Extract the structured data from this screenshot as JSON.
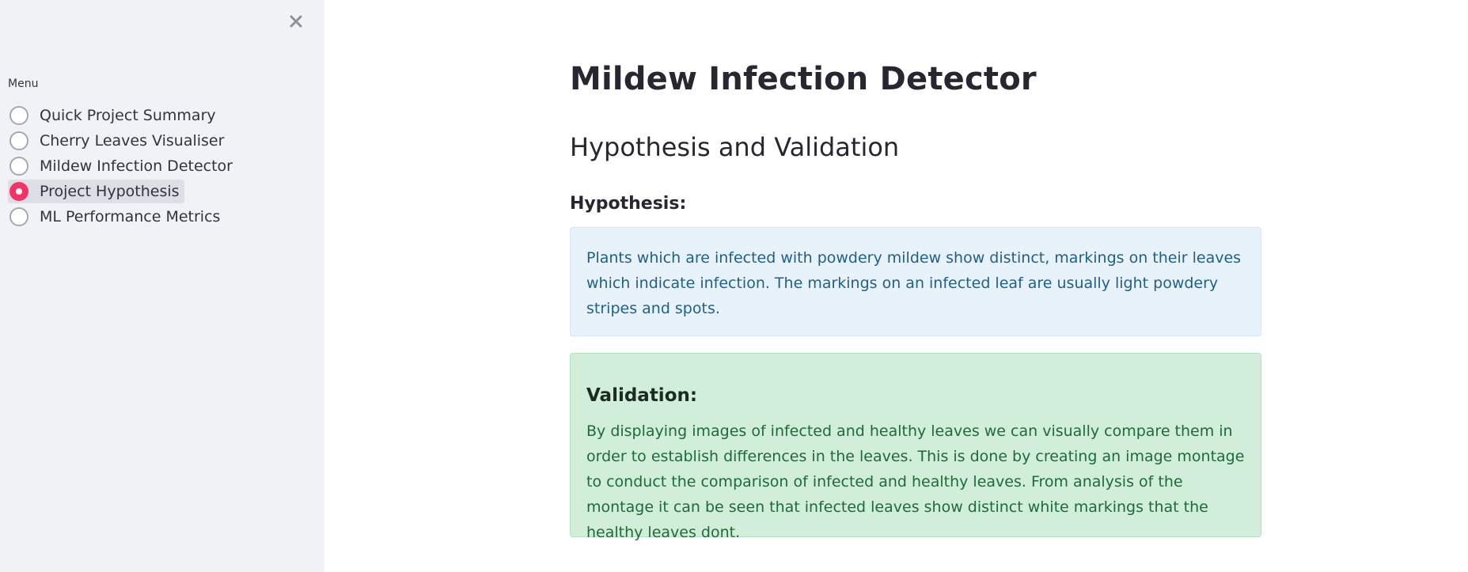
{
  "sidebar": {
    "menu_label": "Menu",
    "items": [
      {
        "label": "Quick Project Summary",
        "selected": false
      },
      {
        "label": "Cherry Leaves Visualiser",
        "selected": false
      },
      {
        "label": "Mildew Infection Detector",
        "selected": false
      },
      {
        "label": "Project Hypothesis",
        "selected": true
      },
      {
        "label": "ML Performance Metrics",
        "selected": false
      }
    ],
    "close_icon": "close-icon"
  },
  "main": {
    "title": "Mildew Infection Detector",
    "section_title": "Hypothesis and Validation",
    "hypothesis_heading": "Hypothesis:",
    "hypothesis_text": "Plants which are infected with powdery mildew show distinct, markings on their leaves which indicate infection. The markings on an infected leaf are usually light powdery stripes and spots.",
    "validation_heading": "Validation:",
    "validation_text": "By displaying images of infected and healthy leaves we can visually compare them in order to establish differences in the leaves. This is done by creating an image montage to conduct the comparison of infected and healthy leaves. From analysis of the montage it can be seen that infected leaves show distinct white markings that the healthy leaves dont."
  },
  "colors": {
    "accent": "#f63366",
    "sidebar_bg": "#f0f2f6",
    "info_bg": "#e8f2fb",
    "success_bg": "#d0eed9"
  }
}
